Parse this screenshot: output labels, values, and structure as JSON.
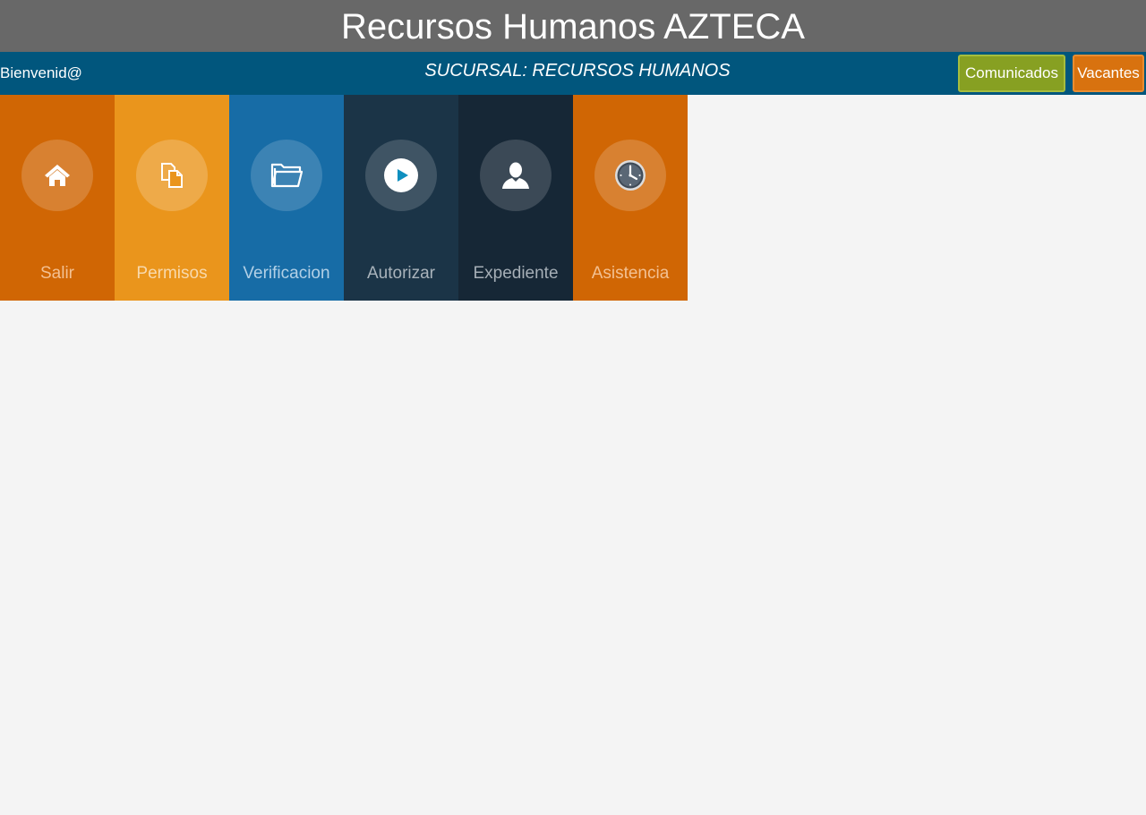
{
  "header": {
    "title": "Recursos Humanos AZTECA"
  },
  "nav": {
    "welcome": "Bienvenid@",
    "branch": "SUCURSAL: RECURSOS HUMANOS",
    "comunicados_label": "Comunicados",
    "vacantes_label": "Vacantes"
  },
  "tiles": [
    {
      "label": "Salir",
      "icon": "home-icon",
      "color": "#d06604"
    },
    {
      "label": "Permisos",
      "icon": "documents-icon",
      "color": "#ea951c"
    },
    {
      "label": "Verificacion",
      "icon": "folder-icon",
      "color": "#176ca6"
    },
    {
      "label": "Autorizar",
      "icon": "play-icon",
      "color": "#1b3447"
    },
    {
      "label": "Expediente",
      "icon": "user-icon",
      "color": "#162736"
    },
    {
      "label": "Asistencia",
      "icon": "clock-icon",
      "color": "#d06604"
    }
  ],
  "colors": {
    "title_bar": "#686868",
    "nav_bar": "#01567d",
    "comunicados_button": "#87a022",
    "vacantes_button": "#d8720f",
    "page_background": "#f4f4f4"
  }
}
